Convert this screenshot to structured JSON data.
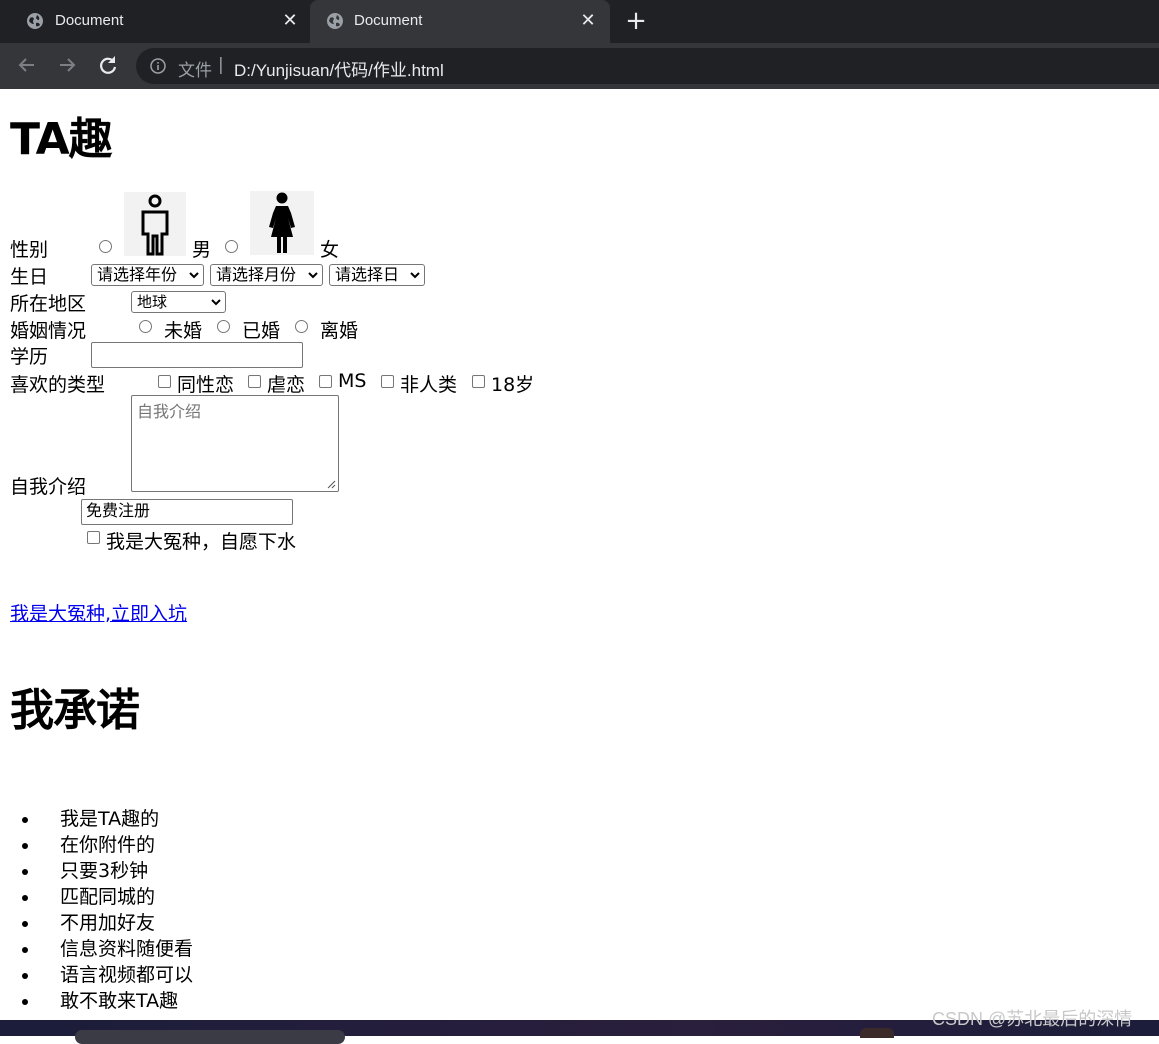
{
  "browser": {
    "tabs": [
      {
        "title": "Document",
        "active": false
      },
      {
        "title": "Document",
        "active": true
      }
    ],
    "address": {
      "prefix": "文件",
      "separator": "|",
      "url": "D:/Yunjisuan/代码/作业.html"
    }
  },
  "page": {
    "title": "TA趣",
    "form": {
      "gender": {
        "label": "性别",
        "options": [
          "男",
          "女"
        ]
      },
      "birthday": {
        "label": "生日",
        "year": "请选择年份",
        "month": "请选择月份",
        "day": "请选择日"
      },
      "region": {
        "label": "所在地区",
        "value": "地球"
      },
      "marital": {
        "label": "婚姻情况",
        "options": [
          "未婚",
          "已婚",
          "离婚"
        ]
      },
      "education": {
        "label": "学历",
        "value": ""
      },
      "likes": {
        "label": "喜欢的类型",
        "options": [
          "同性恋",
          "虐恋",
          "MS",
          "非人类",
          "18岁"
        ]
      },
      "intro": {
        "label": "自我介绍",
        "placeholder": "自我介绍"
      },
      "register": {
        "value": "免费注册"
      },
      "agree": {
        "label": "我是大冤种，自愿下水"
      }
    },
    "link": "我是大冤种,立即入坑",
    "promise_title": "我承诺",
    "promises": [
      "我是TA趣的",
      "在你附件的",
      "只要3秒钟",
      "匹配同城的",
      "不用加好友",
      "信息资料随便看",
      "语言视频都可以",
      "敢不敢来TA趣"
    ]
  },
  "watermark": "CSDN @苏北最后的深情"
}
